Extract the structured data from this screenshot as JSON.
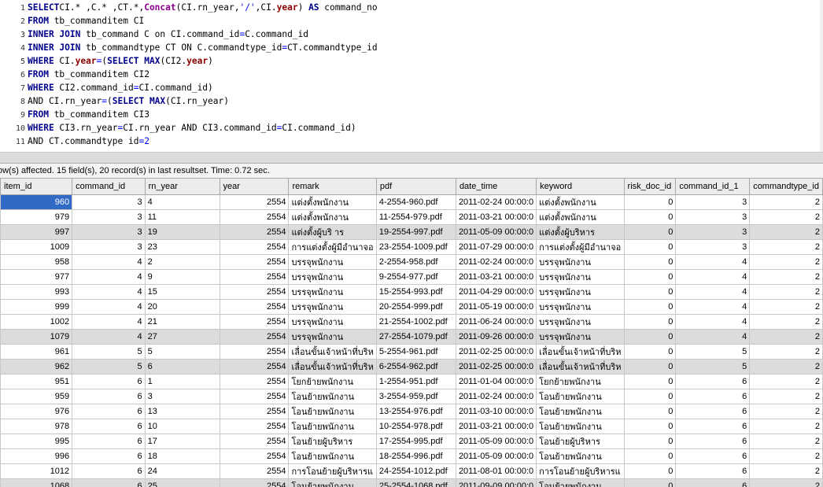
{
  "editor": {
    "lines": [
      {
        "n": "1",
        "segs": [
          [
            "kw",
            "SELECT"
          ],
          [
            "",
            "CI.* ,C.* ,CT.*,"
          ],
          [
            "fn",
            "Concat"
          ],
          [
            "",
            "(CI.rn_year,"
          ],
          [
            "str",
            "'/'"
          ],
          [
            "",
            ",CI."
          ],
          [
            "id",
            "year"
          ],
          [
            "",
            ") "
          ],
          [
            "kw",
            "AS"
          ],
          [
            "",
            " command_no"
          ]
        ]
      },
      {
        "n": "2",
        "segs": [
          [
            "kw",
            "FROM"
          ],
          [
            "",
            " tb_commanditem CI"
          ]
        ]
      },
      {
        "n": "3",
        "segs": [
          [
            "kw",
            "INNER JOIN"
          ],
          [
            "",
            " tb_command C on CI.command_id"
          ],
          [
            "op",
            "="
          ],
          [
            "",
            "C.command_id"
          ]
        ]
      },
      {
        "n": "4",
        "segs": [
          [
            "kw",
            "INNER JOIN"
          ],
          [
            "",
            " tb_commandtype CT ON C.commandtype_id"
          ],
          [
            "op",
            "="
          ],
          [
            "",
            "CT.commandtype_id"
          ]
        ]
      },
      {
        "n": "5",
        "segs": [
          [
            "kw",
            "WHERE"
          ],
          [
            "",
            " CI."
          ],
          [
            "id",
            "year"
          ],
          [
            "op",
            "="
          ],
          [
            "",
            "("
          ],
          [
            "kw",
            "SELECT MAX"
          ],
          [
            "",
            "(CI2."
          ],
          [
            "id",
            "year"
          ],
          [
            "",
            ")"
          ]
        ]
      },
      {
        "n": "6",
        "segs": [
          [
            "kw",
            "FROM"
          ],
          [
            "",
            " tb_commanditem CI2"
          ]
        ]
      },
      {
        "n": "7",
        "segs": [
          [
            "kw",
            "WHERE"
          ],
          [
            "",
            " CI2.command_id"
          ],
          [
            "op",
            "="
          ],
          [
            "",
            "CI.command_id)"
          ]
        ]
      },
      {
        "n": "8",
        "segs": [
          [
            "",
            "AND CI.rn_year"
          ],
          [
            "op",
            "="
          ],
          [
            "",
            "("
          ],
          [
            "kw",
            "SELECT MAX"
          ],
          [
            "",
            "(CI.rn_year)"
          ]
        ]
      },
      {
        "n": "9",
        "segs": [
          [
            "kw",
            "FROM"
          ],
          [
            "",
            " tb_commanditem CI3"
          ]
        ]
      },
      {
        "n": "10",
        "segs": [
          [
            "kw",
            "WHERE"
          ],
          [
            "",
            " CI3.rn_year"
          ],
          [
            "op",
            "="
          ],
          [
            "",
            "CI.rn_year AND CI3.command_id"
          ],
          [
            "op",
            "="
          ],
          [
            "",
            "CI.command_id)"
          ]
        ]
      },
      {
        "n": "11",
        "segs": [
          [
            "",
            "AND CT.commandtype id"
          ],
          [
            "op",
            "="
          ],
          [
            "num",
            "2"
          ]
        ]
      }
    ]
  },
  "status": {
    "text": "ow(s) affected. 15 field(s), 20 record(s) in last resultset. Time: 0.72 sec."
  },
  "grid": {
    "columns": [
      {
        "label": "item_id",
        "align": "r"
      },
      {
        "label": "command_id",
        "align": "r"
      },
      {
        "label": "rn_year",
        "align": "l"
      },
      {
        "label": "year",
        "align": "r"
      },
      {
        "label": "remark",
        "align": "l"
      },
      {
        "label": "pdf",
        "align": "l"
      },
      {
        "label": "date_time",
        "align": "l"
      },
      {
        "label": "keyword",
        "align": "l"
      },
      {
        "label": "risk_doc_id",
        "align": "r"
      },
      {
        "label": "command_id_1",
        "align": "r"
      },
      {
        "label": "commandtype_id",
        "align": "r"
      }
    ],
    "rows": [
      [
        "960",
        "3",
        "4",
        "2554",
        "แต่งตั้งพนักงาน",
        "4-2554-960.pdf",
        "2011-02-24 00:00:0",
        "แต่งตั้งพนักงาน",
        "0",
        "3",
        "2"
      ],
      [
        "979",
        "3",
        "11",
        "2554",
        "แต่งตั้งพนักงาน",
        "11-2554-979.pdf",
        "2011-03-21 00:00:0",
        "แต่งตั้งพนักงาน",
        "0",
        "3",
        "2"
      ],
      [
        "997",
        "3",
        "19",
        "2554",
        "แต่งตั้งผู้บริ าร",
        "19-2554-997.pdf",
        "2011-05-09 00:00:0",
        "แต่งตั้งผู้บริหาร",
        "0",
        "3",
        "2"
      ],
      [
        "1009",
        "3",
        "23",
        "2554",
        "การแต่งตั้งผู้มีอำนาจอ",
        "23-2554-1009.pdf",
        "2011-07-29 00:00:0",
        "การแต่งตั้งผู้มีอำนาจอ",
        "0",
        "3",
        "2"
      ],
      [
        "958",
        "4",
        "2",
        "2554",
        "บรรจุพนักงาน",
        "2-2554-958.pdf",
        "2011-02-24 00:00:0",
        "บรรจุพนักงาน",
        "0",
        "4",
        "2"
      ],
      [
        "977",
        "4",
        "9",
        "2554",
        "บรรจุพนักงาน",
        "9-2554-977.pdf",
        "2011-03-21 00:00:0",
        "บรรจุพนักงาน",
        "0",
        "4",
        "2"
      ],
      [
        "993",
        "4",
        "15",
        "2554",
        "บรรจุพนักงาน",
        "15-2554-993.pdf",
        "2011-04-29 00:00:0",
        "บรรจุพนักงาน",
        "0",
        "4",
        "2"
      ],
      [
        "999",
        "4",
        "20",
        "2554",
        "บรรจุพนักงาน",
        "20-2554-999.pdf",
        "2011-05-19 00:00:0",
        "บรรจุพนักงาน",
        "0",
        "4",
        "2"
      ],
      [
        "1002",
        "4",
        "21",
        "2554",
        "บรรจุพนักงาน",
        "21-2554-1002.pdf",
        "2011-06-24 00:00:0",
        "บรรจุพนักงาน",
        "0",
        "4",
        "2"
      ],
      [
        "1079",
        "4",
        "27",
        "2554",
        "บรรจุพนักงาน",
        "27-2554-1079.pdf",
        "2011-09-26 00:00:0",
        "บรรจุพนักงาน",
        "0",
        "4",
        "2"
      ],
      [
        "961",
        "5",
        "5",
        "2554",
        "เลื่อนขั้นเจ้าหน้าที่บริห",
        "5-2554-961.pdf",
        "2011-02-25 00:00:0",
        "เลื่อนขั้นเจ้าหน้าที่บริห",
        "0",
        "5",
        "2"
      ],
      [
        "962",
        "5",
        "6",
        "2554",
        "เลื่อนขั้นเจ้าหน้าที่บริห",
        "6-2554-962.pdf",
        "2011-02-25 00:00:0",
        "เลื่อนขั้นเจ้าหน้าที่บริห",
        "0",
        "5",
        "2"
      ],
      [
        "951",
        "6",
        "1",
        "2554",
        "โยกย้ายพนักงาน",
        "1-2554-951.pdf",
        "2011-01-04 00:00:0",
        "โยกย้ายพนักงาน",
        "0",
        "6",
        "2"
      ],
      [
        "959",
        "6",
        "3",
        "2554",
        "โอนย้ายพนักงาน",
        "3-2554-959.pdf",
        "2011-02-24 00:00:0",
        "โอนย้ายพนักงาน",
        "0",
        "6",
        "2"
      ],
      [
        "976",
        "6",
        "13",
        "2554",
        "โอนย้ายพนักงาน",
        "13-2554-976.pdf",
        "2011-03-10 00:00:0",
        "โอนย้ายพนักงาน",
        "0",
        "6",
        "2"
      ],
      [
        "978",
        "6",
        "10",
        "2554",
        "โอนย้ายพนักงาน",
        "10-2554-978.pdf",
        "2011-03-21 00:00:0",
        "โอนย้ายพนักงาน",
        "0",
        "6",
        "2"
      ],
      [
        "995",
        "6",
        "17",
        "2554",
        "โอนย้ายผู้บริหาร",
        "17-2554-995.pdf",
        "2011-05-09 00:00:0",
        "โอนย้ายผู้บริหาร",
        "0",
        "6",
        "2"
      ],
      [
        "996",
        "6",
        "18",
        "2554",
        "โอนย้ายพนักงาน",
        "18-2554-996.pdf",
        "2011-05-09 00:00:0",
        "โอนย้ายพนักงาน",
        "0",
        "6",
        "2"
      ],
      [
        "1012",
        "6",
        "24",
        "2554",
        "การโอนย้ายผู้บริหารแ",
        "24-2554-1012.pdf",
        "2011-08-01 00:00:0",
        "การโอนย้ายผู้บริหารแ",
        "0",
        "6",
        "2"
      ],
      [
        "1068",
        "6",
        "25",
        "2554",
        "โอนย้ายพนักงาน",
        "25-2554-1068.pdf",
        "2011-09-09 00:00:0",
        "โอนย้ายพนักงาน",
        "0",
        "6",
        "2"
      ]
    ],
    "alt_rows": [
      2,
      9,
      11,
      19
    ],
    "selected_row": 0
  }
}
